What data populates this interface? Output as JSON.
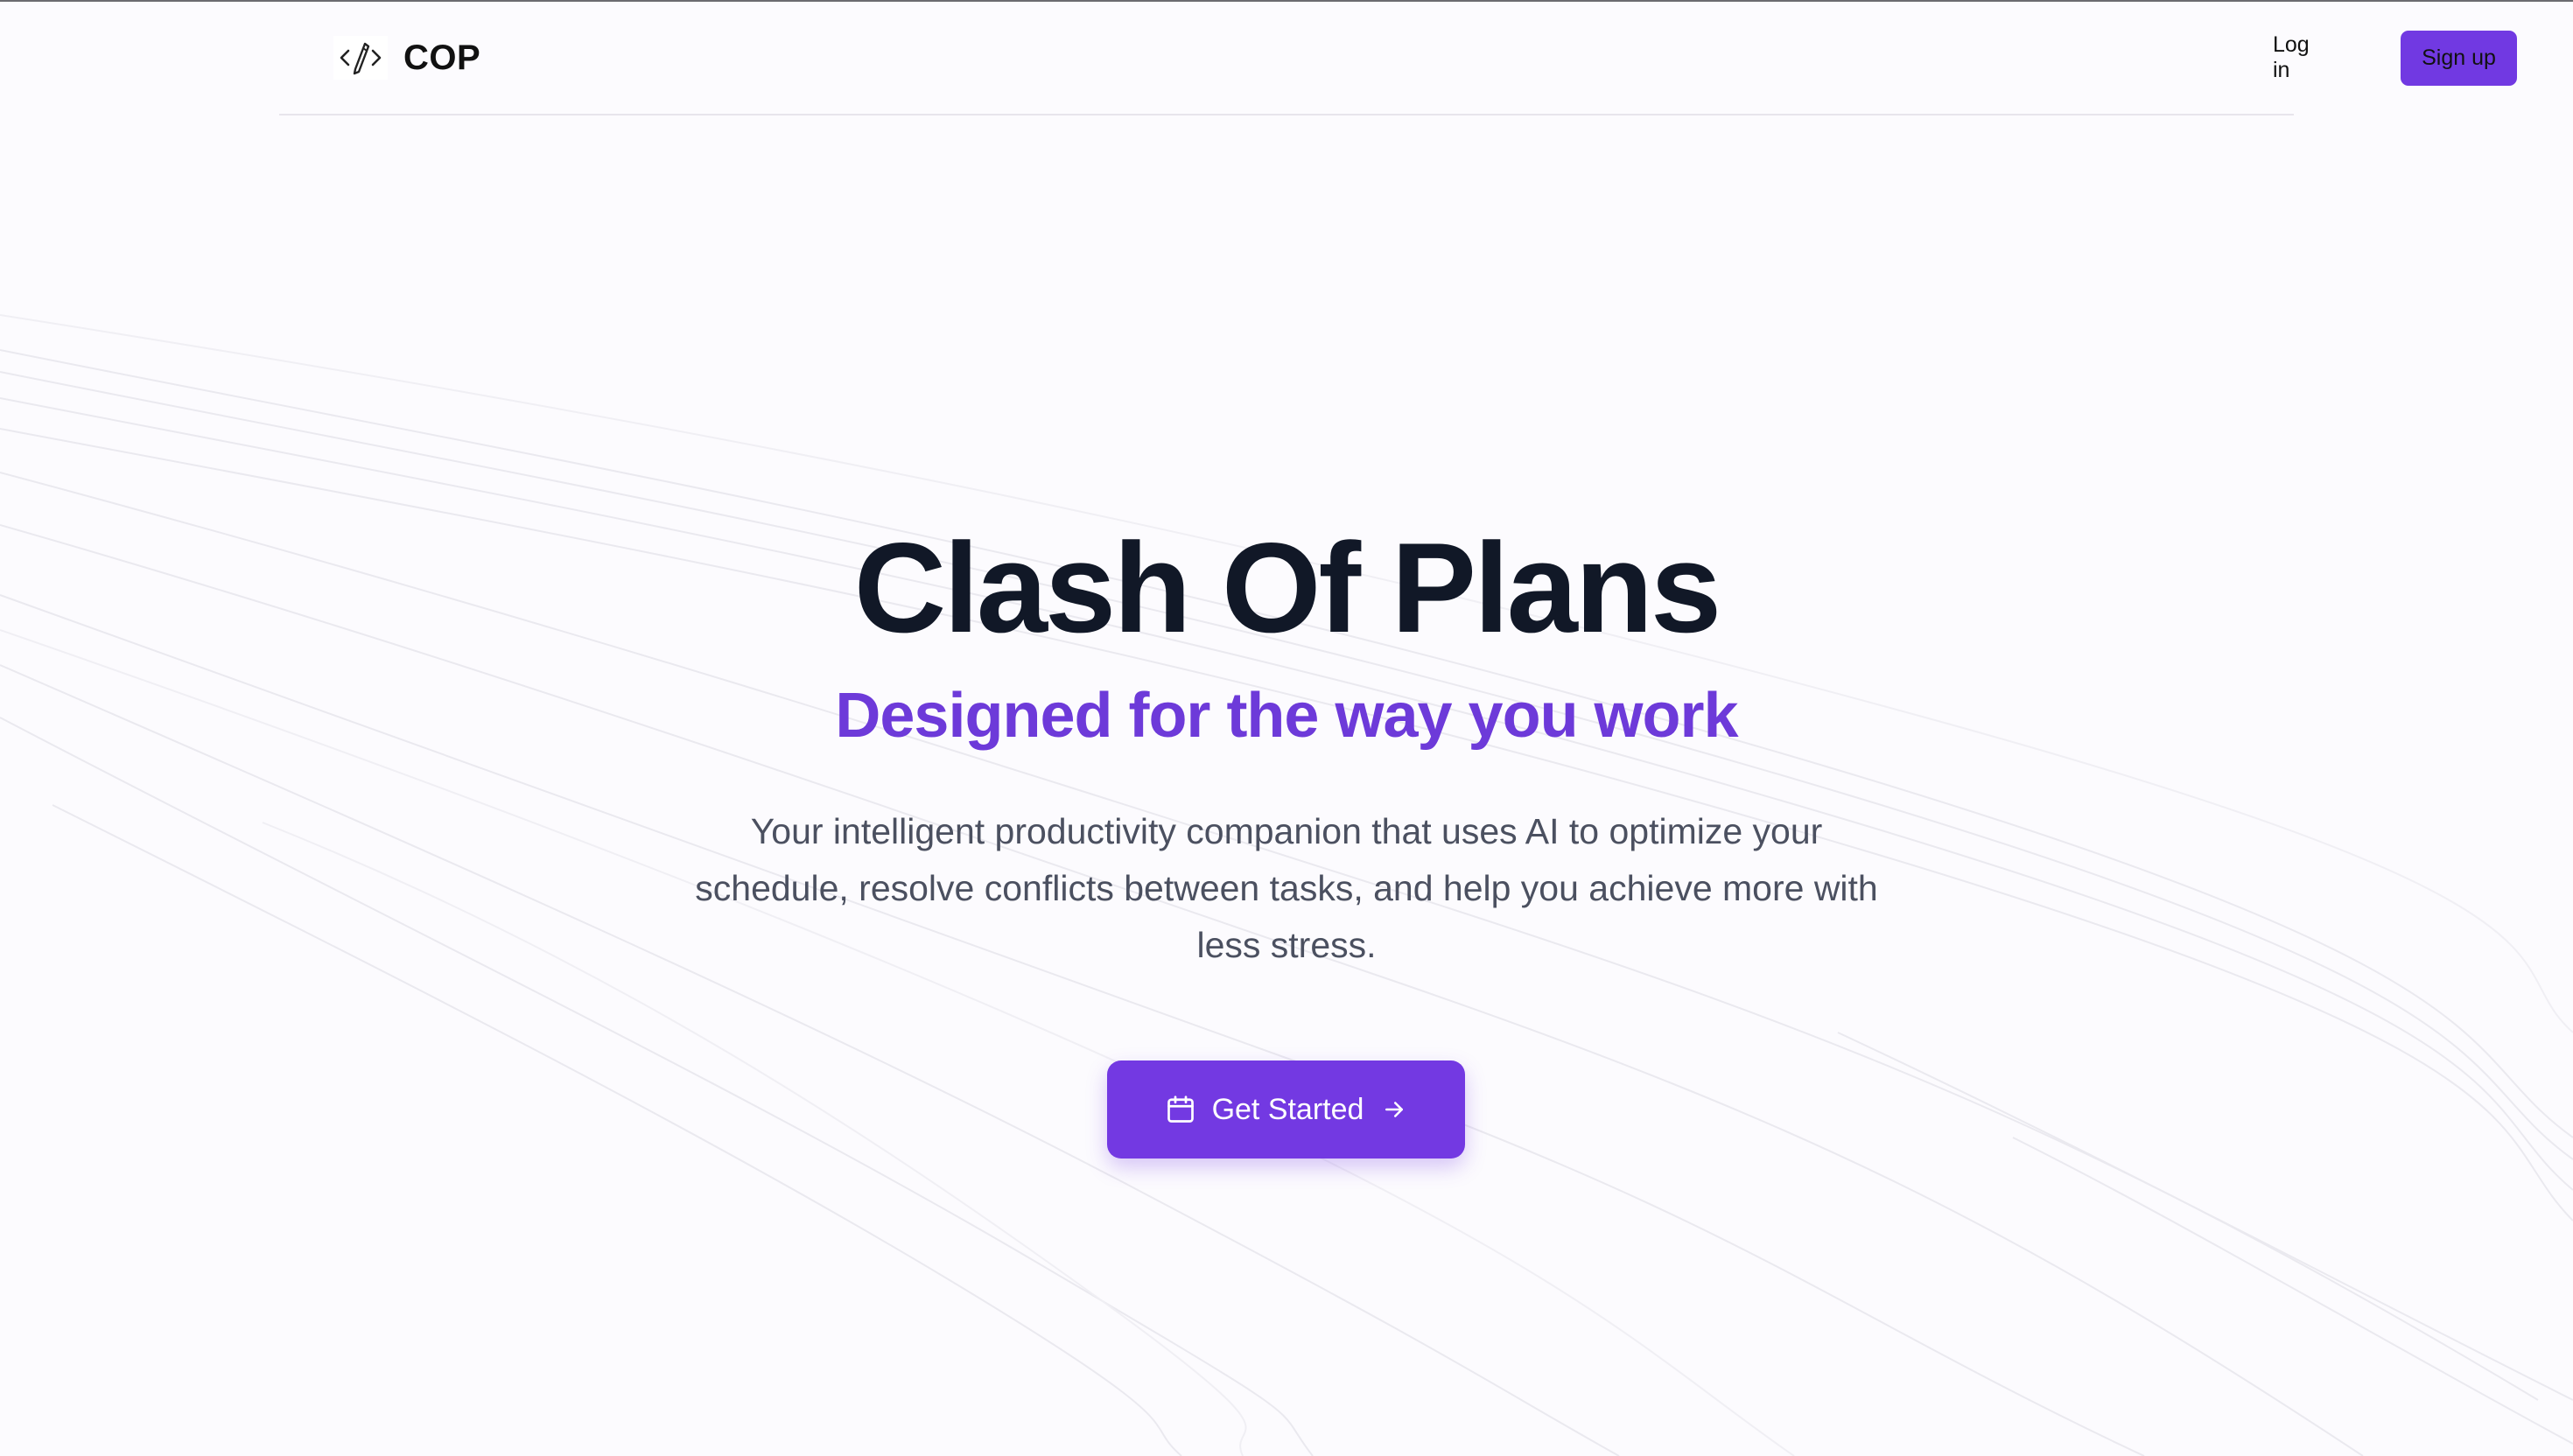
{
  "header": {
    "brand_name": "COP",
    "logo_icon": "code-pencil-icon",
    "login_label": "Log in",
    "signup_label": "Sign up"
  },
  "hero": {
    "title": "Clash Of Plans",
    "subtitle": "Designed for the way you work",
    "description": "Your intelligent productivity companion that uses AI to optimize your schedule, resolve conflicts between tasks, and help you achieve more with less stress.",
    "cta": {
      "label": "Get Started",
      "leading_icon": "calendar-icon",
      "trailing_icon": "arrow-right-icon"
    }
  },
  "colors": {
    "accent": "#7339e2",
    "subtitle": "#6d3ad9",
    "title": "#111827",
    "body_text": "#4b5060",
    "background": "#fcfbfe"
  }
}
